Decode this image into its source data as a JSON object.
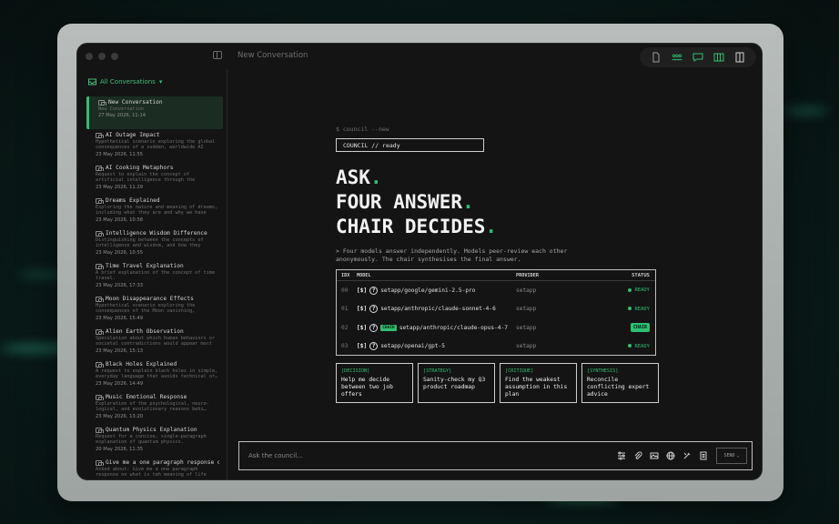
{
  "window": {
    "title": "New Conversation"
  },
  "sidebar": {
    "header": "All Conversations",
    "conversations": [
      {
        "title": "New Conversation",
        "preview": "New Conversation",
        "date": "27 May 2026, 11:14",
        "active": true
      },
      {
        "title": "AI Outage Impact",
        "preview": "Hypothetical scenario exploring the global consequences of a sudden, worldwide AI outa…",
        "date": "23 May 2026, 11:55"
      },
      {
        "title": "AI Cooking Metaphors",
        "preview": "Request to explain the concept of artificial intelligence through the exclusive use of c…",
        "date": "23 May 2026, 11:29"
      },
      {
        "title": "Dreams Explained",
        "preview": "Exploring the nature and meaning of dreams, including what they are and why we have the…",
        "date": "23 May 2026, 10:58"
      },
      {
        "title": "Intelligence Wisdom Difference",
        "preview": "Distinguishing between the concepts of intelligence and wisdom, and how they relat…",
        "date": "23 May 2026, 10:55"
      },
      {
        "title": "Time Travel Explanation",
        "preview": "A brief explanation of the concept of time travel.",
        "date": "23 May 2026, 17:33"
      },
      {
        "title": "Moon Disappearance Effects",
        "preview": "Hypothetical scenario exploring the consequences of the Moon vanishing, includi…",
        "date": "23 May 2026, 15:49"
      },
      {
        "title": "Alien Earth Observation",
        "preview": "Speculation about which human behaviors or societal contradictions would appear most b…",
        "date": "23 May 2026, 15:13"
      },
      {
        "title": "Black Holes Explained",
        "preview": "A request to explain black holes in simple, everyday language that avoids technical or…",
        "date": "23 May 2026, 14:49"
      },
      {
        "title": "Music Emotional Response",
        "preview": "Exploration of the psychological, neuro-logical, and evolutionary reasons behi…",
        "date": "23 May 2026, 13:20"
      },
      {
        "title": "Quantum Physics Explanation",
        "preview": "Request for a concise, single-paragraph explanation of quantum physics.",
        "date": "20 May 2026, 11:35"
      },
      {
        "title": "Give me a one paragraph response on …",
        "preview": "Asked about: Give me a one paragraph response on what is teh meaning of life for…",
        "date": "20 May 2026, 11:28"
      }
    ]
  },
  "main": {
    "command": "$ council --new",
    "status": "COUNCIL // ready",
    "hero": {
      "line1": "ASK",
      "line2": "FOUR ANSWER",
      "line3": "CHAIR DECIDES",
      "dot": "."
    },
    "description": "> Four models answer independently. Models peer-review each other anonymously. The chair synthesises the final answer.",
    "table": {
      "headers": {
        "idx": "IDX",
        "model": "MODEL",
        "provider": "PROVIDER",
        "status": "STATUS"
      },
      "rows": [
        {
          "idx": "00",
          "badge": "[$]",
          "q": "?",
          "model": "setapp/google/gemini-2.5-pro",
          "provider": "setapp",
          "status": "READY"
        },
        {
          "idx": "01",
          "badge": "[$]",
          "q": "?",
          "model": "setapp/anthropic/claude-sonnet-4-6",
          "provider": "setapp",
          "status": "READY"
        },
        {
          "idx": "02",
          "badge": "[$]",
          "q": "?",
          "chair": "CHAIR",
          "model": "setapp/anthropic/claude-opus-4-7",
          "provider": "setapp",
          "status": "CHAIR"
        },
        {
          "idx": "03",
          "badge": "[$]",
          "q": "?",
          "model": "setapp/openai/gpt-5",
          "provider": "setapp",
          "status": "READY"
        }
      ]
    },
    "cards": [
      {
        "tag": "[DECISION]",
        "text": "Help me decide between two job offers"
      },
      {
        "tag": "[STRATEGY]",
        "text": "Sanity-check my Q3 product roadmap"
      },
      {
        "tag": "[CRITIQUE]",
        "text": "Find the weakest assumption in this plan"
      },
      {
        "tag": "[SYNTHESIS]",
        "text": "Reconcile conflicting expert advice"
      }
    ],
    "composer": {
      "placeholder": "Ask the council...",
      "send": "SEND"
    }
  },
  "colors": {
    "accent": "#2fbf70",
    "background": "#141414"
  }
}
